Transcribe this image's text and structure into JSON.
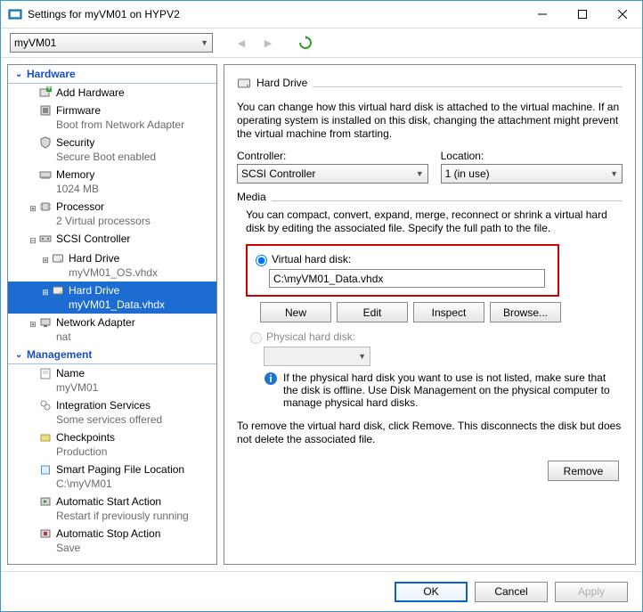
{
  "window": {
    "title": "Settings for myVM01 on HYPV2"
  },
  "toolbar": {
    "vm_selected": "myVM01"
  },
  "tree": {
    "hardware_label": "Hardware",
    "management_label": "Management",
    "items": {
      "add_hardware": "Add Hardware",
      "firmware": "Firmware",
      "firmware_sub": "Boot from Network Adapter",
      "security": "Security",
      "security_sub": "Secure Boot enabled",
      "memory": "Memory",
      "memory_sub": "1024 MB",
      "processor": "Processor",
      "processor_sub": "2 Virtual processors",
      "scsi": "SCSI Controller",
      "hd1": "Hard Drive",
      "hd1_sub": "myVM01_OS.vhdx",
      "hd2": "Hard Drive",
      "hd2_sub": "myVM01_Data.vhdx",
      "netadapter": "Network Adapter",
      "netadapter_sub": "nat",
      "name": "Name",
      "name_sub": "myVM01",
      "integration": "Integration Services",
      "integration_sub": "Some services offered",
      "checkpoints": "Checkpoints",
      "checkpoints_sub": "Production",
      "paging": "Smart Paging File Location",
      "paging_sub": "C:\\myVM01",
      "autostart": "Automatic Start Action",
      "autostart_sub": "Restart if previously running",
      "autostop": "Automatic Stop Action",
      "autostop_sub": "Save"
    }
  },
  "detail": {
    "header": "Hard Drive",
    "intro": "You can change how this virtual hard disk is attached to the virtual machine. If an operating system is installed on this disk, changing the attachment might prevent the virtual machine from starting.",
    "controller_label": "Controller:",
    "controller_value": "SCSI Controller",
    "location_label": "Location:",
    "location_value": "1 (in use)",
    "media_label": "Media",
    "media_desc": "You can compact, convert, expand, merge, reconnect or shrink a virtual hard disk by editing the associated file. Specify the full path to the file.",
    "vhd_radio": "Virtual hard disk:",
    "vhd_path": "C:\\myVM01_Data.vhdx",
    "btn_new": "New",
    "btn_edit": "Edit",
    "btn_inspect": "Inspect",
    "btn_browse": "Browse...",
    "phd_radio": "Physical hard disk:",
    "phd_info": "If the physical hard disk you want to use is not listed, make sure that the disk is offline. Use Disk Management on the physical computer to manage physical hard disks.",
    "remove_desc": "To remove the virtual hard disk, click Remove. This disconnects the disk but does not delete the associated file.",
    "btn_remove": "Remove"
  },
  "footer": {
    "ok": "OK",
    "cancel": "Cancel",
    "apply": "Apply"
  }
}
